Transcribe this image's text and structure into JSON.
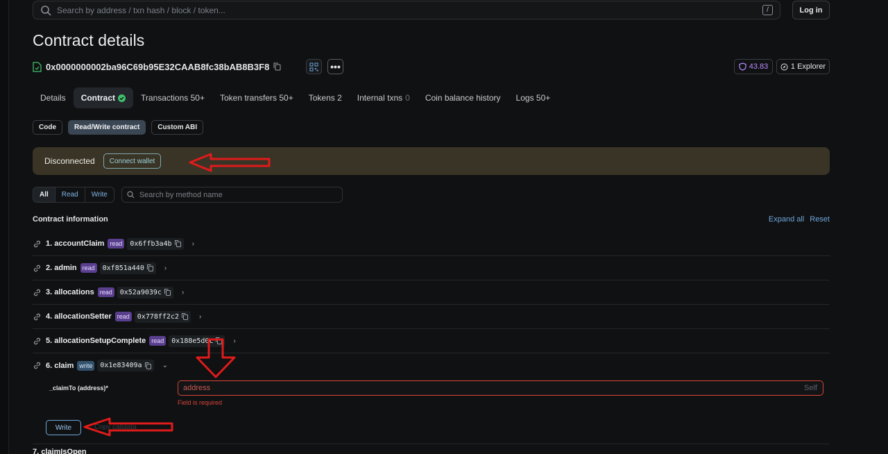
{
  "search": {
    "placeholder": "Search by address / txn hash / block / token...",
    "shortcut": "/"
  },
  "header": {
    "login_label": "Log in"
  },
  "page": {
    "title": "Contract details",
    "address": "0x0000000002ba96C69b95E32CAAB8fc38bAB8B3F8",
    "score": "43.83",
    "explorer_label": "1 Explorer"
  },
  "tabs": [
    {
      "label": "Details"
    },
    {
      "label": "Contract"
    },
    {
      "label": "Transactions 50+"
    },
    {
      "label": "Token transfers 50+"
    },
    {
      "label": "Tokens 2"
    },
    {
      "label": "Internal txns",
      "count": "0"
    },
    {
      "label": "Coin balance history"
    },
    {
      "label": "Logs 50+"
    }
  ],
  "subtabs": [
    {
      "label": "Code"
    },
    {
      "label": "Read/Write contract"
    },
    {
      "label": "Custom ABI"
    }
  ],
  "wallet": {
    "status": "Disconnected",
    "connect_label": "Connect wallet"
  },
  "filter": {
    "segments": [
      "All",
      "Read",
      "Write"
    ],
    "search_placeholder": "Search by method name"
  },
  "contract_info": {
    "title": "Contract information",
    "expand_all": "Expand all",
    "reset": "Reset"
  },
  "methods": [
    {
      "name": "1. accountClaim",
      "type": "read",
      "selector": "0x6ffb3a4b"
    },
    {
      "name": "2. admin",
      "type": "read",
      "selector": "0xf851a440"
    },
    {
      "name": "3. allocations",
      "type": "read",
      "selector": "0x52a9039c"
    },
    {
      "name": "4. allocationSetter",
      "type": "read",
      "selector": "0x778ff2c2"
    },
    {
      "name": "5. allocationSetupComplete",
      "type": "read",
      "selector": "0x188e5d0c"
    },
    {
      "name": "6. claim",
      "type": "write",
      "selector": "0x1e83409a"
    }
  ],
  "claim_form": {
    "param_label": "_claimTo (address)*",
    "input_placeholder": "address",
    "self_label": "Self",
    "error": "Field is required",
    "write_label": "Write",
    "copy_calldata": "Copy calldata"
  },
  "next_method": {
    "name": "7. claimIsOpen"
  },
  "colors": {
    "annotation_red": "#e01b1b",
    "accent_blue": "#6fa7dd",
    "read_badge": "#5a3f8f",
    "warning_bar": "#3a3426"
  }
}
